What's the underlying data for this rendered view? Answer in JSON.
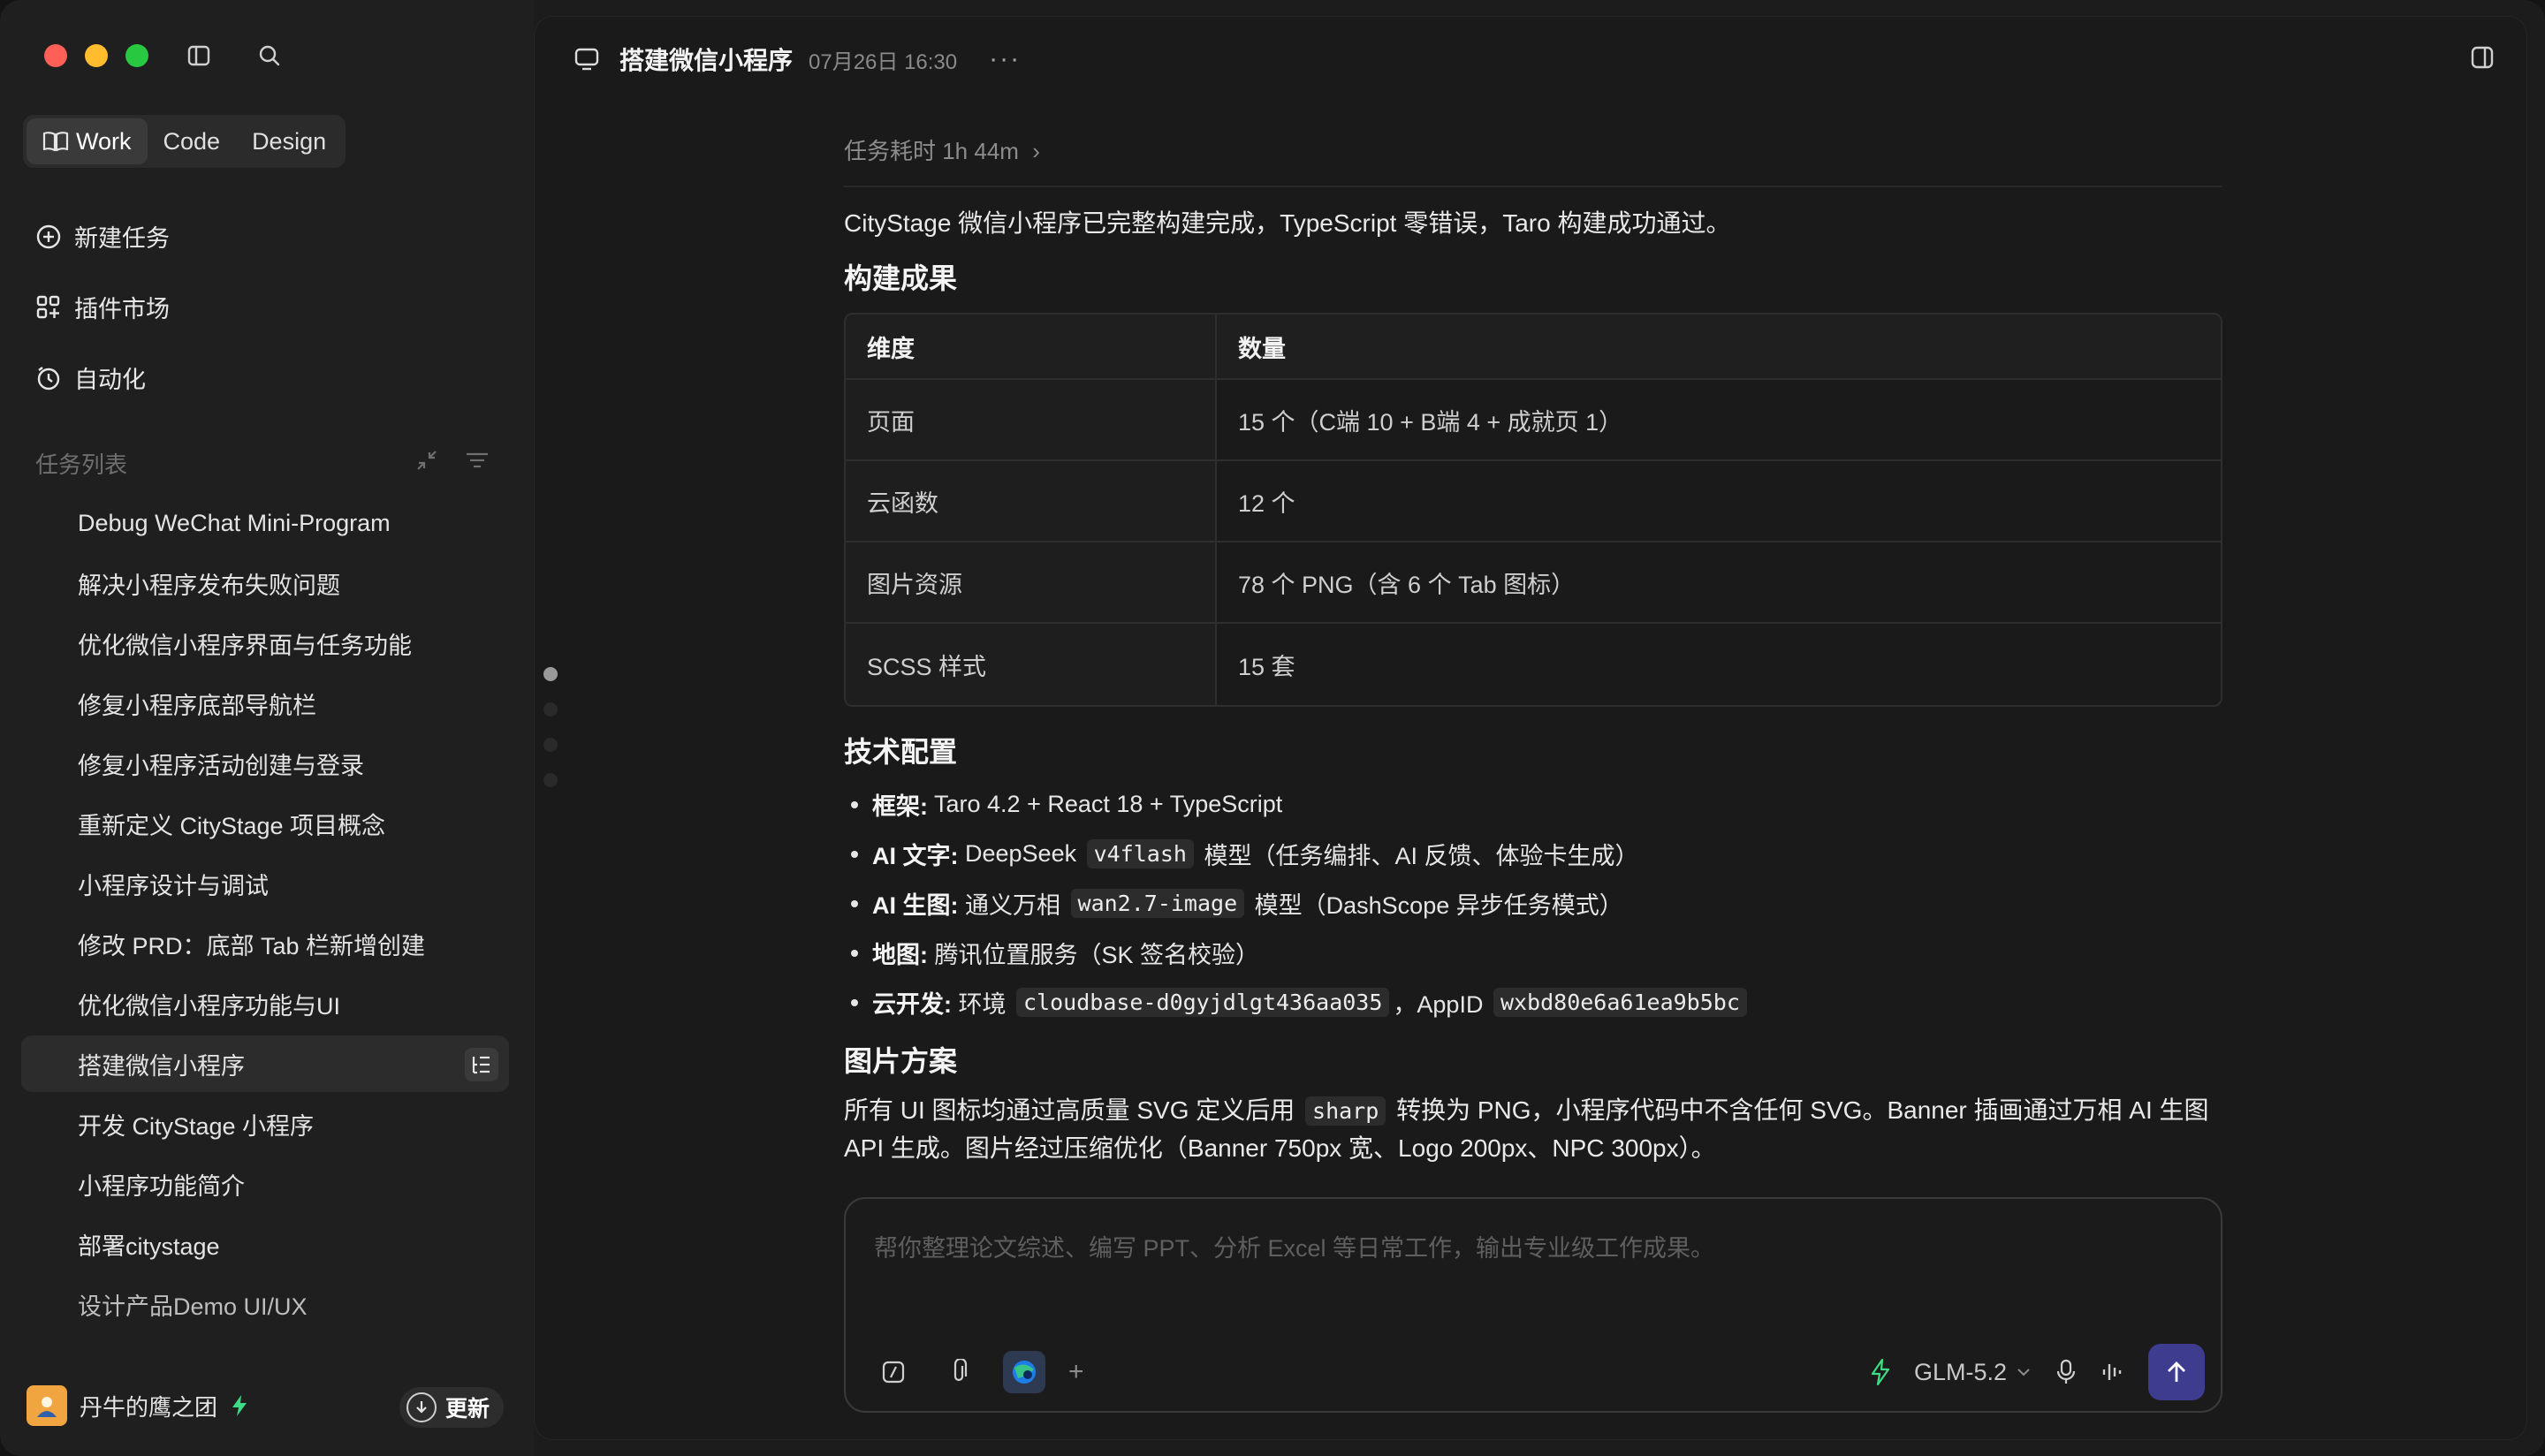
{
  "sidebar": {
    "mode_tabs": [
      "Work",
      "Code",
      "Design"
    ],
    "nav": [
      {
        "label": "新建任务",
        "icon": "plus-circle-icon"
      },
      {
        "label": "插件市场",
        "icon": "grid-plus-icon"
      },
      {
        "label": "自动化",
        "icon": "clock-icon"
      }
    ],
    "section_title": "任务列表",
    "tasks": [
      "Debug WeChat Mini-Program",
      "解决小程序发布失败问题",
      "优化微信小程序界面与任务功能",
      "修复小程序底部导航栏",
      "修复小程序活动创建与登录",
      "重新定义 CityStage 项目概念",
      "小程序设计与调试",
      "修改 PRD：底部 Tab 栏新增创建",
      "优化微信小程序功能与UI",
      "搭建微信小程序",
      "开发 CityStage 小程序",
      "小程序功能简介",
      "部署citystage",
      "设计产品Demo UI/UX"
    ],
    "active_task_index": 9,
    "user_name": "丹牛的鹰之团",
    "update_label": "更新"
  },
  "header": {
    "title": "搭建微信小程序",
    "time": "07月26日 16:30",
    "more": "···"
  },
  "content": {
    "duration": "任务耗时 1h 44m",
    "summary": "CityStage 微信小程序已完整构建完成，TypeScript 零错误，Taro 构建成功通过。",
    "heading_build": "构建成果",
    "table": {
      "headers": [
        "维度",
        "数量"
      ],
      "rows": [
        [
          "页面",
          "15 个（C端 10 + B端 4 + 成就页 1）"
        ],
        [
          "云函数",
          "12 个"
        ],
        [
          "图片资源",
          "78 个 PNG（含 6 个 Tab 图标）"
        ],
        [
          "SCSS 样式",
          "15 套"
        ]
      ]
    },
    "heading_tech": "技术配置",
    "tech": [
      {
        "key": "框架:",
        "text": " Taro 4.2 + React 18 + TypeScript"
      },
      {
        "key": "AI 文字:",
        "pre": " DeepSeek ",
        "code": "v4flash",
        "post": " 模型（任务编排、AI 反馈、体验卡生成）"
      },
      {
        "key": "AI 生图:",
        "pre": " 通义万相 ",
        "code": "wan2.7-image",
        "post": " 模型（DashScope 异步任务模式）"
      },
      {
        "key": "地图:",
        "text": " 腾讯位置服务（SK 签名校验）"
      },
      {
        "key": "云开发:",
        "pre": " 环境 ",
        "code": "cloudbase-d0gyjdlgt436aa035",
        "mid": "，AppID ",
        "code2": "wxbd80e6a61ea9b5bc"
      }
    ],
    "heading_image": "图片方案",
    "image_pre": "所有 UI 图标均通过高质量 SVG 定义后用 ",
    "image_code": "sharp",
    "image_post": " 转换为 PNG，小程序代码中不含任何 SVG。Banner 插画通过万相 AI 生图 API 生成。图片经过压缩优化（Banner 750px 宽、Logo 200px、NPC 300px）。"
  },
  "composer": {
    "placeholder": "帮你整理论文综述、编写 PPT、分析 Excel 等日常工作，输出专业级工作成果。",
    "model": "GLM-5.2",
    "plus": "+"
  },
  "colors": {
    "accent": "#3d3c8f",
    "bolt": "#3ddc84",
    "send": "#3d3c8f"
  }
}
